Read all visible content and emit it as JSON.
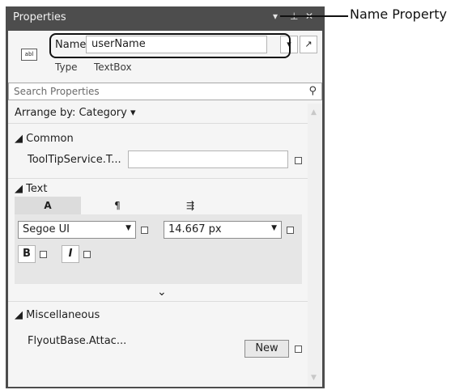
{
  "panel": {
    "title": "Properties",
    "controls": {
      "dropdown": "▾",
      "pin": "⊥",
      "close": "✕"
    }
  },
  "header": {
    "element_icon_text": "abl",
    "name_label": "Name",
    "name_value": "userName",
    "type_label": "Type",
    "type_value": "TextBox",
    "btn1": "▾",
    "btn2": "↗"
  },
  "search": {
    "placeholder": "Search Properties"
  },
  "arrange": {
    "label": "Arrange by: Category ▾"
  },
  "categories": {
    "common": {
      "header": "◢ Common",
      "props": [
        {
          "label": "ToolTipService.T..."
        }
      ]
    },
    "text": {
      "header": "◢ Text",
      "tabs": [
        {
          "label": "A"
        },
        {
          "label": "¶"
        },
        {
          "label": "⇶"
        }
      ],
      "font_family": "Segoe UI",
      "font_size": "14.667 px",
      "bold": "B",
      "italic": "I",
      "expand": "⌄"
    },
    "misc": {
      "header": "◢ Miscellaneous",
      "props": [
        {
          "label": "FlyoutBase.Attac...",
          "button": "New"
        }
      ]
    }
  },
  "callout": {
    "text": "Name Property"
  }
}
